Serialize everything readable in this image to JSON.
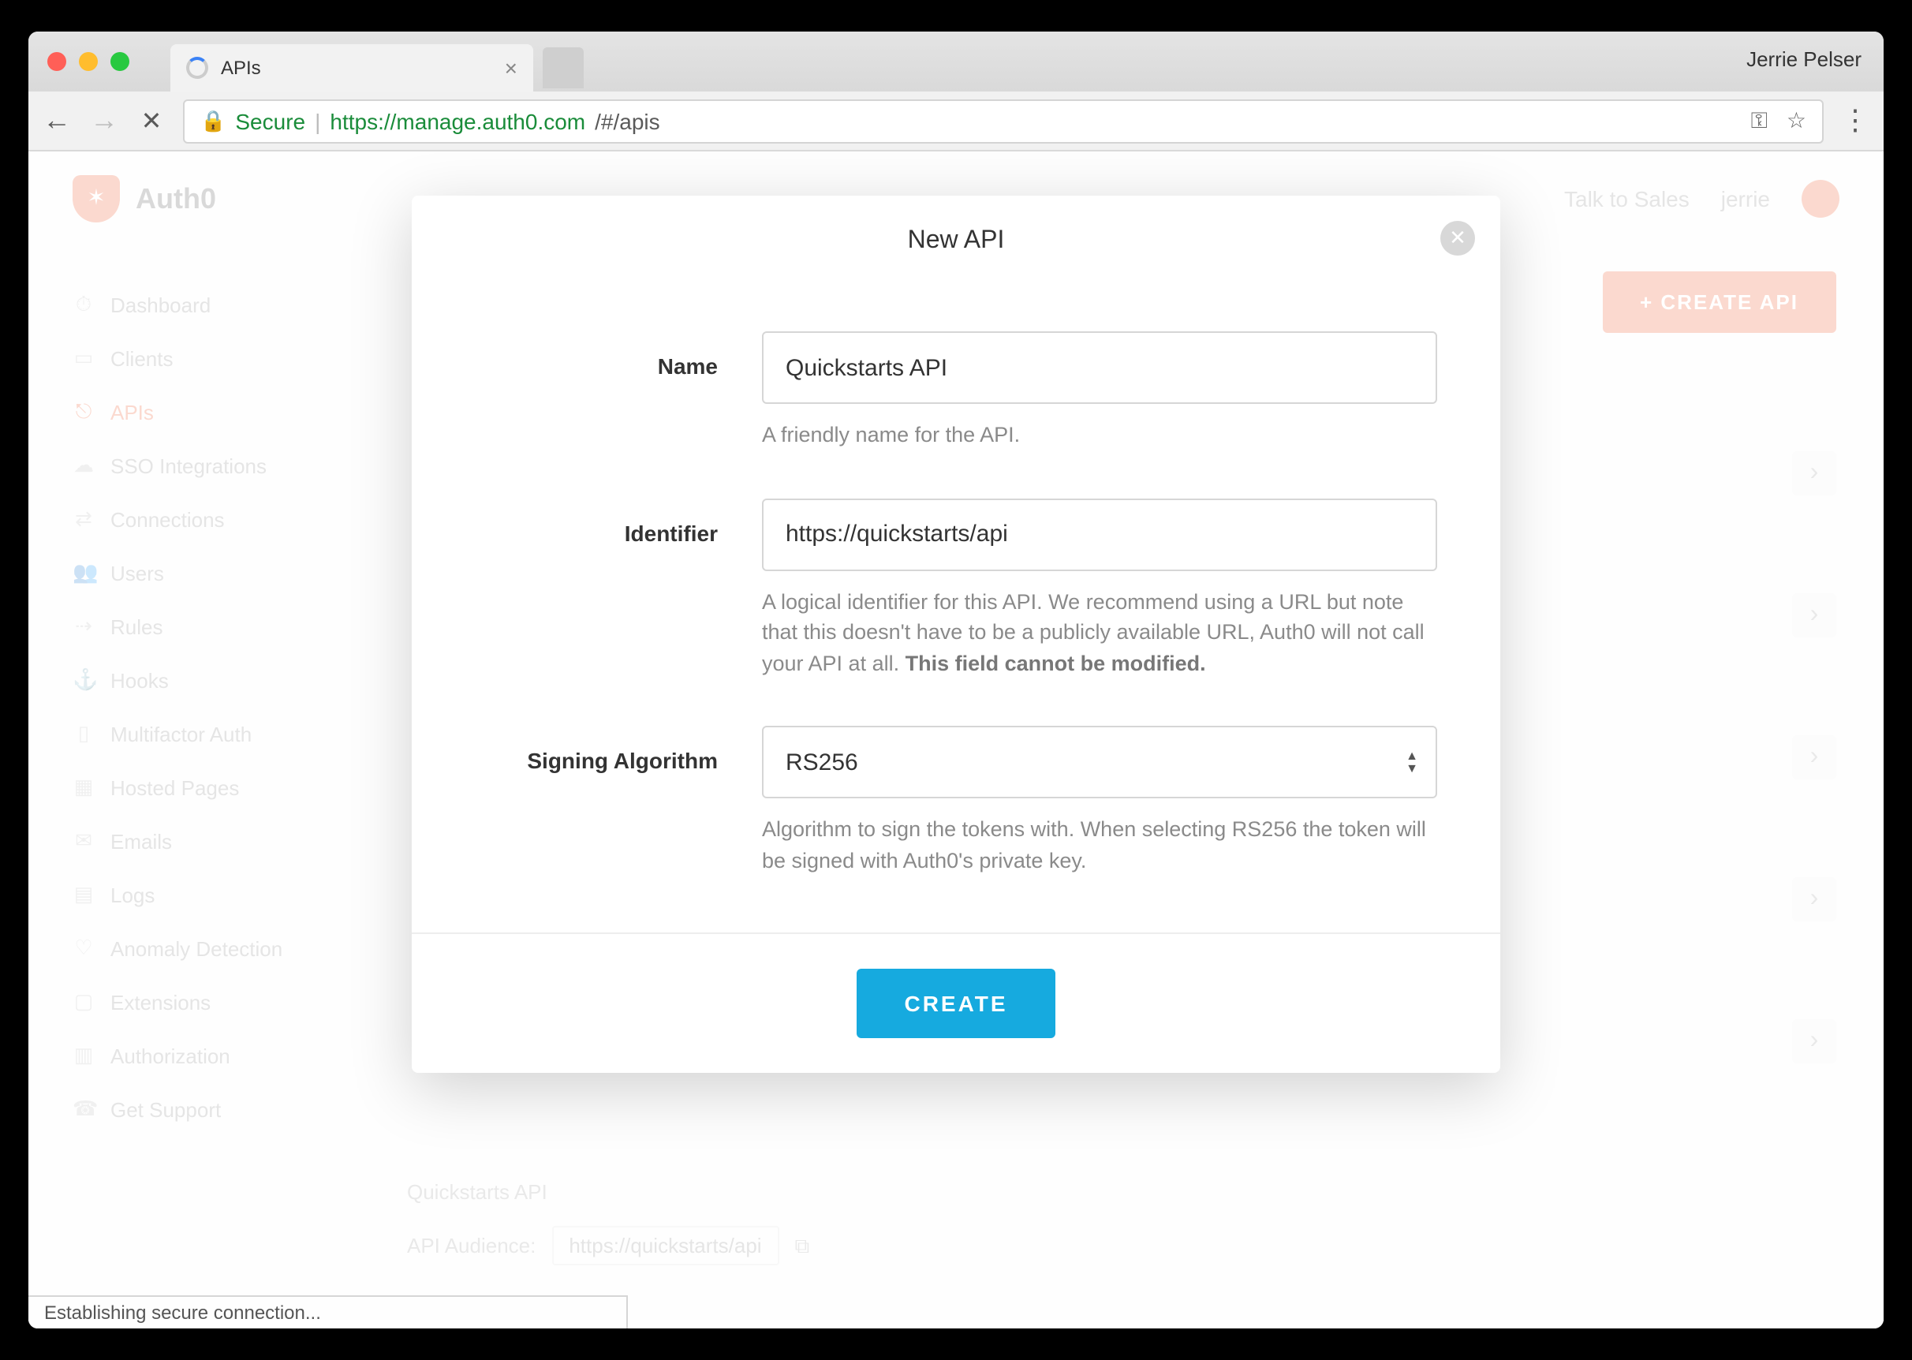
{
  "browser": {
    "profile_name": "Jerrie Pelser",
    "tab_title": "APIs",
    "secure_label": "Secure",
    "url_scheme_host": "https://manage.auth0.com",
    "url_path": "/#/apis",
    "status_text": "Establishing secure connection..."
  },
  "topbar": {
    "brand": "Auth0",
    "talk_to_sales": "Talk to Sales",
    "username": "jerrie"
  },
  "sidebar": {
    "items": [
      {
        "icon": "⏱",
        "label": "Dashboard"
      },
      {
        "icon": "▭",
        "label": "Clients"
      },
      {
        "icon": "⎋",
        "label": "APIs"
      },
      {
        "icon": "☁",
        "label": "SSO Integrations"
      },
      {
        "icon": "⇄",
        "label": "Connections"
      },
      {
        "icon": "👥",
        "label": "Users"
      },
      {
        "icon": "⇢",
        "label": "Rules"
      },
      {
        "icon": "⚓",
        "label": "Hooks"
      },
      {
        "icon": "▯",
        "label": "Multifactor Auth"
      },
      {
        "icon": "▦",
        "label": "Hosted Pages"
      },
      {
        "icon": "✉",
        "label": "Emails"
      },
      {
        "icon": "▤",
        "label": "Logs"
      },
      {
        "icon": "♡",
        "label": "Anomaly Detection"
      },
      {
        "icon": "▢",
        "label": "Extensions"
      },
      {
        "icon": "▥",
        "label": "Authorization"
      },
      {
        "icon": "☎",
        "label": "Get Support"
      }
    ]
  },
  "main": {
    "create_button": "+ CREATE API",
    "existing_api_name": "Quickstarts API",
    "audience_label": "API Audience:",
    "audience_value": "https://quickstarts/api"
  },
  "modal": {
    "title": "New API",
    "name_label": "Name",
    "name_value": "Quickstarts API",
    "name_help": "A friendly name for the API.",
    "identifier_label": "Identifier",
    "identifier_value": "https://quickstarts/api",
    "identifier_help_pre": "A logical identifier for this API. We recommend using a URL but note that this doesn't have to be a publicly available URL, Auth0 will not call your API at all. ",
    "identifier_help_bold": "This field cannot be modified.",
    "algo_label": "Signing Algorithm",
    "algo_value": "RS256",
    "algo_help": "Algorithm to sign the tokens with. When selecting RS256 the token will be signed with Auth0's private key.",
    "create_button": "CREATE"
  }
}
